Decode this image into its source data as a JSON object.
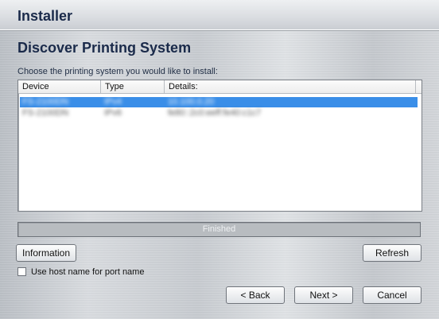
{
  "window": {
    "title": "Installer"
  },
  "page": {
    "title": "Discover Printing System",
    "instruction": "Choose the printing system you would like to install:"
  },
  "list": {
    "columns": [
      "Device",
      "Type",
      "Details:"
    ],
    "rows": [
      {
        "device": "FS-2100DN",
        "type": "IPv4",
        "details": "10.100.0.20",
        "selected": true
      },
      {
        "device": "FS-2100DN",
        "type": "IPv6",
        "details": "fe80::2c0:eeff:fe40:c1c7",
        "selected": false
      }
    ]
  },
  "status": {
    "text": "Finished"
  },
  "buttons": {
    "information": "Information",
    "refresh": "Refresh",
    "back": "< Back",
    "next": "Next >",
    "cancel": "Cancel"
  },
  "options": {
    "use_host_name": "Use host name for port name",
    "use_host_name_checked": false
  }
}
